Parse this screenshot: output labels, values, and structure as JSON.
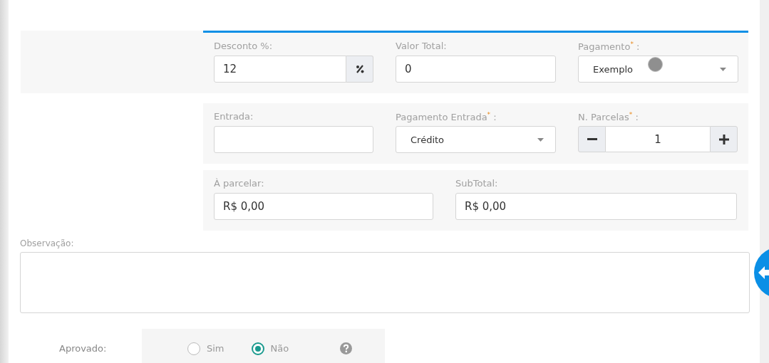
{
  "sections": [
    {
      "kind": "highlighted",
      "fields": [
        {
          "label": "Desconto %:",
          "kind": "addon",
          "value": "12"
        },
        {
          "label": "Valor Total:",
          "kind": "text",
          "value": "0"
        },
        {
          "label": "Pagamento$^{*}$ :",
          "kind": "select",
          "value": "Exemplo"
        }
      ]
    },
    {
      "kind": "plain",
      "fields": [
        {
          "label": "Entrada:",
          "kind": "text"
        },
        {
          "label": "Pagamento Entrada$^{*}$ :",
          "kind": "select",
          "value": "Crédito"
        },
        {
          "label": "N. Parcelas$^{*}$ :",
          "kind": "stepper",
          "value": "1"
        }
      ]
    },
    {
      "kind": "plain",
      "fields": [
        {
          "label": "À parcelar:",
          "kind": "text",
          "value": "R$ 0,00"
        },
        {
          "label": "SubTotal:",
          "kind": "text",
          "value": "R$ 0,00"
        }
      ]
    }
  ],
  "observacao": {
    "label": "Observação:"
  },
  "aprovado": {
    "label": "Aprovado:",
    "options": [
      {
        "label": "Sim",
        "selected": false
      },
      {
        "label": "Não",
        "selected": true
      }
    ]
  }
}
